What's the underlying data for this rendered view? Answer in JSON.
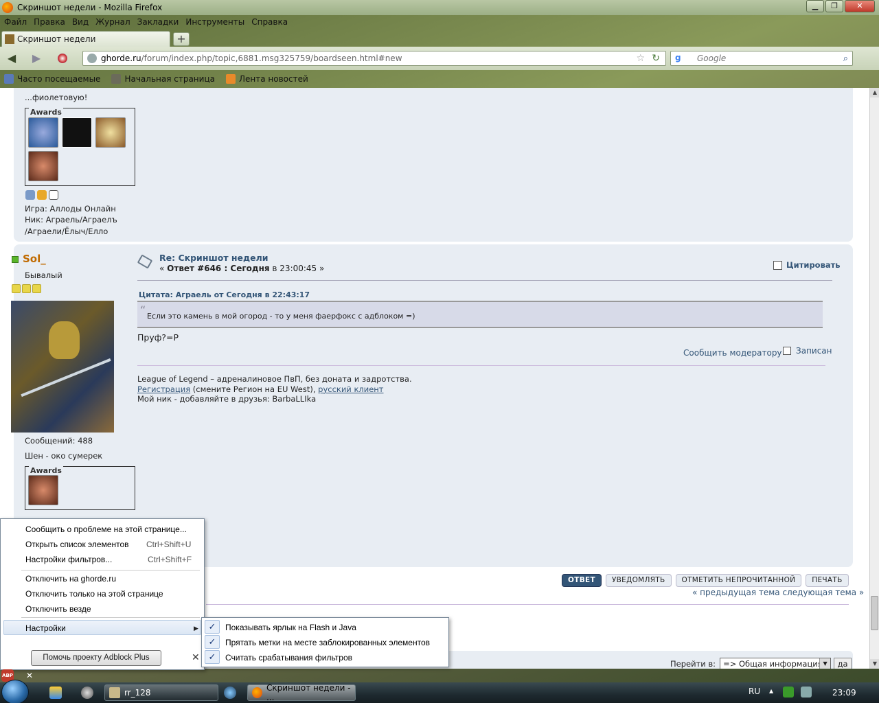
{
  "window": {
    "title": "Скриншот недели - Mozilla Firefox",
    "min": "▁",
    "max": "❐",
    "close": "✕"
  },
  "menu": [
    "Файл",
    "Правка",
    "Вид",
    "Журнал",
    "Закладки",
    "Инструменты",
    "Справка"
  ],
  "tab": {
    "label": "Скриншот недели",
    "new_tab": "+"
  },
  "nav": {
    "back": "◀",
    "forward": "▶",
    "url_domain": "ghorde.ru",
    "url_path": "/forum/index.php/topic,6881.msg325759/boardseen.html#new",
    "star": "☆",
    "reload": "↻",
    "search_placeholder": "Google",
    "search_logo": "g",
    "search_icon": "⌕"
  },
  "bookmarks": [
    "Часто посещаемые",
    "Начальная страница",
    "Лента новостей"
  ],
  "post_prev": {
    "text_top": "...фиолетовую!",
    "awards_label": "Awards",
    "game": "Игра: Аллоды Онлайн",
    "nick_line1": "Ник: Аграель/Аграелъ",
    "nick_line2": "/Аграели/Ёлыч/Елло"
  },
  "post": {
    "username": "Sol_",
    "rank": "Бывалый",
    "subject": "Re: Скриншот недели",
    "meta_prefix": "« ",
    "meta_bold": "Ответ #646 : Сегодня",
    "meta_suffix": " в 23:00:45 »",
    "quote_button": "Цитировать",
    "quote_header": "Цитата: Аграель от Сегодня в 22:43:17",
    "quote_mark": "“",
    "quote_text": "Если это камень в мой огород - то у меня фаерфокс с адблоком =)",
    "body": "Пруф?=P",
    "report": "Сообщить модератору",
    "saved": "Записан",
    "sig_line1": "League of Legend – адреналиновое ПвП, без доната и задротства.",
    "sig_link1": "Регистрация",
    "sig_mid": " (смените Регион на EU West), ",
    "sig_link2": "русский клиент",
    "sig_line3": "Мой ник - добавляйте в друзья: BarbaLLIka",
    "messages": "Сообщений: 488",
    "personal_text": "Шен - око сумерек",
    "awards_label": "Awards"
  },
  "thread_buttons": [
    "ОТВЕТ",
    "УВЕДОМЛЯТЬ",
    "ОТМЕТИТЬ НЕПРОЧИТАННОЙ",
    "ПЕЧАТЬ"
  ],
  "thread_nav": "« предыдущая тема следующая тема »",
  "goto": {
    "label": "Перейти в:",
    "selected": "=> Общая информация",
    "button": "да",
    "dropdown": "▼"
  },
  "abp_menu": {
    "items": [
      {
        "label": "Сообщить о проблеме на этой странице...",
        "shortcut": ""
      },
      {
        "label": "Открыть список элементов",
        "shortcut": "Ctrl+Shift+U"
      },
      {
        "label": "Настройки фильтров...",
        "shortcut": "Ctrl+Shift+F"
      },
      {
        "label": "Отключить на ghorde.ru",
        "shortcut": ""
      },
      {
        "label": "Отключить только на этой странице",
        "shortcut": ""
      },
      {
        "label": "Отключить везде",
        "shortcut": ""
      },
      {
        "label": "Настройки",
        "shortcut": ""
      }
    ],
    "help_button": "Помочь проекту Adblock Plus",
    "submenu_arrow": "▶",
    "close_x": "✕",
    "check_glyph": "✓",
    "submenu": [
      "Показывать ярлык на Flash и Java",
      "Прятать метки на месте заблокированных элементов",
      "Считать срабатывания фильтров"
    ]
  },
  "abp_icon": {
    "badge": "ABP",
    "close": "✕"
  },
  "taskbar": {
    "task1": "rr_128",
    "task2": "Скриншот недели - ...",
    "lang": "RU",
    "tray_arrow": "▲",
    "clock": "23:09"
  }
}
